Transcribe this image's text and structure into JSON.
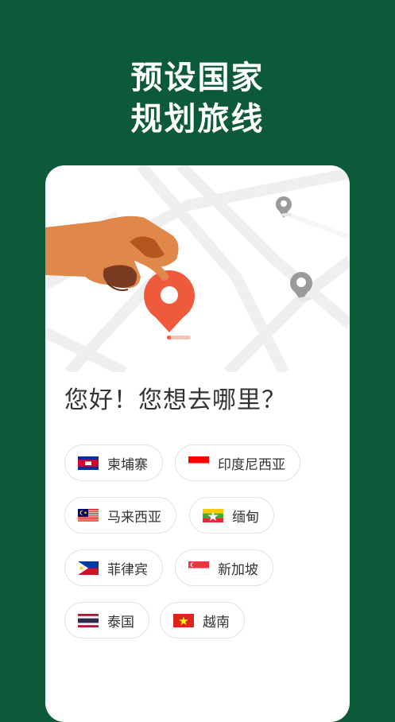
{
  "headline": {
    "line1": "预设国家",
    "line2": "规划旅线"
  },
  "greeting": "您好！您想去哪里？",
  "countries": [
    {
      "name": "柬埔寨",
      "flag": "cambodia-flag-icon"
    },
    {
      "name": "印度尼西亚",
      "flag": "indonesia-flag-icon"
    },
    {
      "name": "马来西亚",
      "flag": "malaysia-flag-icon"
    },
    {
      "name": "缅甸",
      "flag": "myanmar-flag-icon"
    },
    {
      "name": "菲律宾",
      "flag": "philippines-flag-icon"
    },
    {
      "name": "新加坡",
      "flag": "singapore-flag-icon"
    },
    {
      "name": "泰国",
      "flag": "thailand-flag-icon"
    },
    {
      "name": "越南",
      "flag": "vietnam-flag-icon"
    }
  ],
  "colors": {
    "background": "#0c5a3a",
    "accent": "#f05a3c",
    "hand": "#e0884a"
  }
}
